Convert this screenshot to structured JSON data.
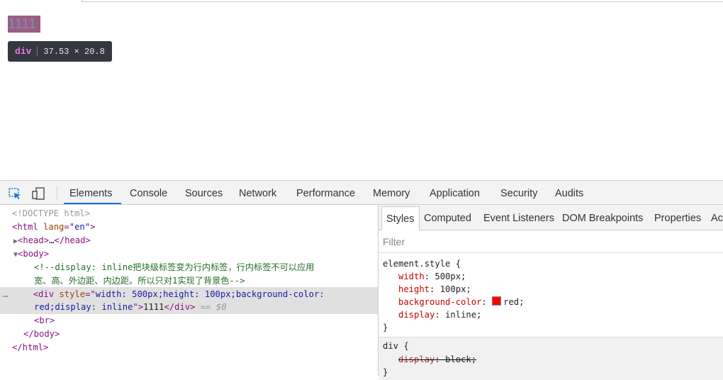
{
  "page": {
    "demo_text": "1111",
    "tooltip": {
      "tag": "div",
      "dimensions": "37.53 × 20.8"
    }
  },
  "devtools": {
    "tabs": [
      "Elements",
      "Console",
      "Sources",
      "Network",
      "Performance",
      "Memory",
      "Application",
      "Security",
      "Audits"
    ],
    "active_tab": "Elements",
    "dom": {
      "doctype": "<!DOCTYPE html>",
      "html_open_tag": "<html",
      "html_attr": "lang",
      "html_attr_value": "\"en\"",
      "html_open_close": ">",
      "head_open": "<head>",
      "head_ellipsis": "…",
      "head_close": "</head>",
      "body_open": "<body>",
      "comment_line1": "<!--display: inline把块级标签变为行内标签，行内标签不可以应用",
      "comment_line2": "宽、高、外边距、内边距。所以只对1实现了背景色-->",
      "div_open": "<div",
      "div_attr": "style",
      "div_attr_eq": "=\"",
      "div_style_line1": "width: 500px;height: 100px;background-color:",
      "div_style_line2": "red;display: inline",
      "div_attr_end": "\">",
      "div_text": "1111",
      "div_close": "</div>",
      "selected_marker": "== $0",
      "row_dots": "…",
      "br": "<br>",
      "body_close": "</body>",
      "html_close": "</html>"
    },
    "styles_pane": {
      "tabs": [
        "Styles",
        "Computed",
        "Event Listeners",
        "DOM Breakpoints",
        "Properties",
        "Ac"
      ],
      "active_tab": "Styles",
      "filter_placeholder": "Filter",
      "element_style_selector": "element.style {",
      "element_style_props": [
        {
          "name": "width",
          "value": "500px;"
        },
        {
          "name": "height",
          "value": "100px;"
        },
        {
          "name": "background-color",
          "value": "red;"
        },
        {
          "name": "display",
          "value": "inline;"
        }
      ],
      "close_brace": "}",
      "div_rule_selector": "div {",
      "div_rule_prop": {
        "name": "display",
        "value": "block;"
      },
      "swatch_color": "#ff0000"
    }
  }
}
